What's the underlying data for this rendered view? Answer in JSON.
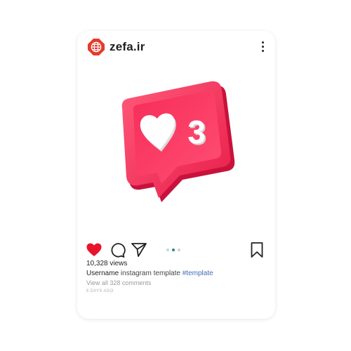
{
  "post": {
    "brand": "zefa.ir",
    "badge_count": "3",
    "views": "10,328 views",
    "username": "Username",
    "caption_text": "instagram template",
    "hashtag": "#template",
    "comments_link": "View all 328 comments",
    "time_ago": "6 DAYS AGO"
  },
  "colors": {
    "badge_red": "#f52f57",
    "like_red": "#e8132c",
    "dot_active": "#3a7f86",
    "dot_inactive": "#c5d6d8"
  },
  "icons": [
    "globe-logo-icon",
    "more-options-icon",
    "heart-icon",
    "comment-icon",
    "share-icon",
    "bookmark-icon"
  ]
}
